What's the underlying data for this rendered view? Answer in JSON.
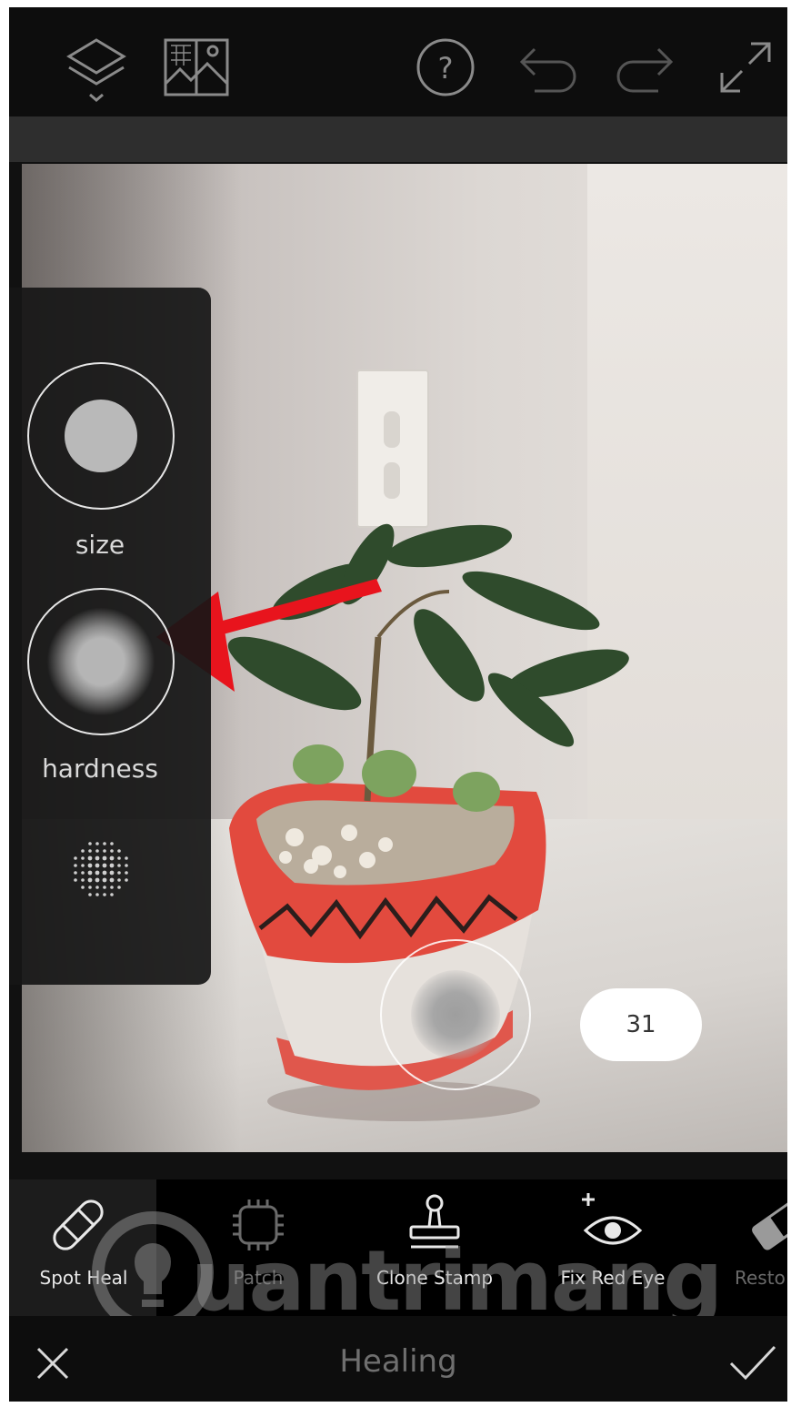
{
  "toolbar": {
    "icons": [
      "layers-icon",
      "image-adjust-icon",
      "help-icon",
      "undo-icon",
      "redo-icon",
      "expand-icon"
    ]
  },
  "brush_panel": {
    "size_label": "size",
    "hardness_label": "hardness"
  },
  "brush_value": "31",
  "tools": [
    {
      "label": "Spot Heal",
      "icon": "bandage-icon"
    },
    {
      "label": "Patch",
      "icon": "patch-icon"
    },
    {
      "label": "Clone Stamp",
      "icon": "clone-stamp-icon"
    },
    {
      "label": "Fix Red Eye",
      "icon": "red-eye-icon"
    },
    {
      "label": "Resto",
      "icon": "eraser-icon"
    }
  ],
  "bottom": {
    "title": "Healing",
    "cancel_icon": "close-icon",
    "confirm_icon": "checkmark-icon"
  },
  "watermark": {
    "text": "uantrimang"
  },
  "colors": {
    "annotation_arrow": "#e8141d",
    "pot_red": "#e04a3f",
    "leaf_green": "#2e4a2a"
  }
}
